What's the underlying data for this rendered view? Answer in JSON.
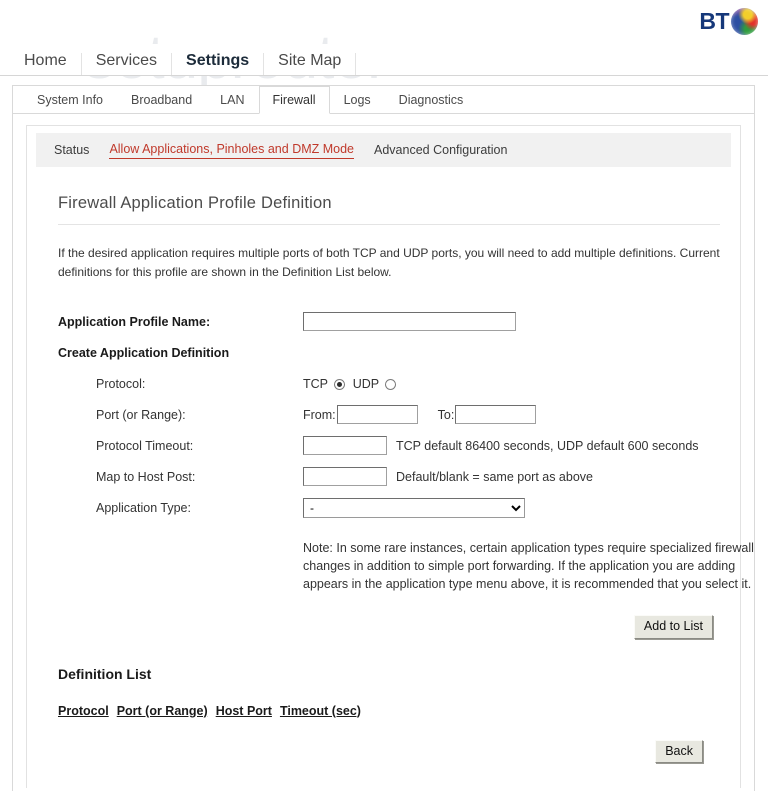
{
  "brand": {
    "logo_text": "BT",
    "logo_icon": "bt-globe-icon"
  },
  "watermark": {
    "text": "setuprouter"
  },
  "main_nav": {
    "items": [
      {
        "label": "Home",
        "active": false
      },
      {
        "label": "Services",
        "active": false
      },
      {
        "label": "Settings",
        "active": true
      },
      {
        "label": "Site Map",
        "active": false
      }
    ]
  },
  "section_tabs": {
    "items": [
      {
        "label": "System Info",
        "active": false
      },
      {
        "label": "Broadband",
        "active": false
      },
      {
        "label": "LAN",
        "active": false
      },
      {
        "label": "Firewall",
        "active": true
      },
      {
        "label": "Logs",
        "active": false
      },
      {
        "label": "Diagnostics",
        "active": false
      }
    ]
  },
  "sub_tabs": {
    "items": [
      {
        "label": "Status",
        "current": false
      },
      {
        "label": "Allow Applications, Pinholes and DMZ Mode",
        "current": true
      },
      {
        "label": "Advanced Configuration",
        "current": false
      }
    ],
    "current_color": "#c0392b"
  },
  "page": {
    "title": "Firewall Application Profile Definition",
    "intro": "If the desired application requires multiple ports of both TCP and UDP ports, you will need to add multiple definitions. Current definitions for this profile are shown in the Definition List below."
  },
  "form": {
    "profile_name_label": "Application Profile Name:",
    "profile_name_value": "",
    "profile_name_placeholder": "",
    "create_definition_heading": "Create Application Definition",
    "protocol_label": "Protocol:",
    "protocol_tcp_label": "TCP",
    "protocol_udp_label": "UDP",
    "protocol_selected": "TCP",
    "port_range_label": "Port (or Range):",
    "port_from_label": "From:",
    "port_from_value": "",
    "port_to_label": "To:",
    "port_to_value": "",
    "timeout_label": "Protocol Timeout:",
    "timeout_value": "",
    "timeout_note": "TCP default 86400 seconds, UDP default 600 seconds",
    "map_host_label": "Map to Host Post:",
    "map_host_value": "",
    "map_host_note": "Default/blank = same port as above",
    "app_type_label": "Application Type:",
    "app_type_selected": "-",
    "app_type_options": [
      "-"
    ],
    "note": "Note: In some rare instances, certain application types require specialized firewall changes in addition to simple port forwarding. If the application you are adding appears in the application type menu above, it is recommended that you select it."
  },
  "actions": {
    "add_to_list_label": "Add to List",
    "back_label": "Back"
  },
  "definition_list": {
    "title": "Definition List",
    "columns": [
      "Protocol",
      "Port (or Range)",
      "Host Port",
      "Timeout (sec)"
    ],
    "rows": []
  }
}
